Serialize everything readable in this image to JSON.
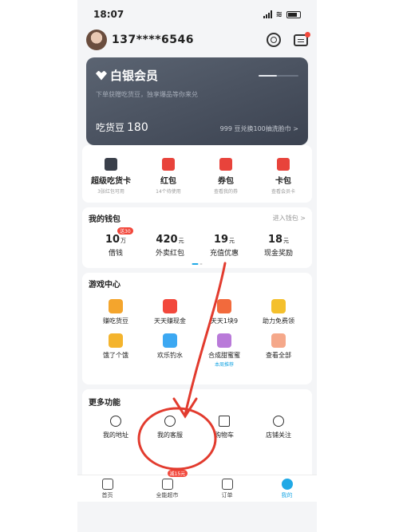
{
  "status": {
    "time": "18:07"
  },
  "header": {
    "phone": "137****6546"
  },
  "member": {
    "title": "白银会员",
    "subtitle": "下单获赠吃货豆，独享爆品等你来兑",
    "progress_fraction": 0.45,
    "beans_label": "吃货豆",
    "beans_value": "180",
    "exchange_link": "999 豆兑换100抽洗脸巾 >"
  },
  "quick": [
    {
      "label": "超级吃货卡",
      "sub": "3张红包可用",
      "icon": "member-card-icon"
    },
    {
      "label": "红包",
      "sub": "14个待使用",
      "icon": "red-packet-icon"
    },
    {
      "label": "券包",
      "sub": "查看我的券",
      "icon": "coupon-icon"
    },
    {
      "label": "卡包",
      "sub": "查看会员卡",
      "icon": "card-wallet-icon"
    }
  ],
  "wallet": {
    "title": "我的钱包",
    "link": "进入钱包 >",
    "items": [
      {
        "value": "10",
        "unit": "万",
        "label": "借钱",
        "badge": "送30"
      },
      {
        "value": "420",
        "unit": "元",
        "label": "外卖红包",
        "badge": ""
      },
      {
        "value": "19",
        "unit": "元",
        "label": "充值优惠",
        "badge": ""
      },
      {
        "value": "18",
        "unit": "元",
        "label": "现金奖励",
        "badge": ""
      }
    ]
  },
  "games": {
    "title": "游戏中心",
    "items": [
      {
        "label": "赚吃货豆",
        "color": "#f4a52d",
        "badge": ""
      },
      {
        "label": "天天赚现金",
        "color": "#f2483c",
        "badge": ""
      },
      {
        "label": "天天1块9",
        "color": "#f26a3c",
        "badge": ""
      },
      {
        "label": "助力免费领",
        "color": "#f4c02d",
        "badge": ""
      },
      {
        "label": "饿了个饿",
        "color": "#f4b42d",
        "badge": ""
      },
      {
        "label": "欢乐钓水",
        "color": "#3ca8f2",
        "badge": ""
      },
      {
        "label": "合成甜蜜蜜",
        "color": "#b97ad9",
        "badge": "本周推荐"
      },
      {
        "label": "查看全部",
        "color": "#f5a88a",
        "badge": ""
      }
    ]
  },
  "more": {
    "title": "更多功能",
    "items": [
      {
        "label": "我的地址",
        "icon": "location-icon"
      },
      {
        "label": "我的客服",
        "icon": "headset-icon"
      },
      {
        "label": "购物车",
        "icon": "cart-icon"
      },
      {
        "label": "店铺关注",
        "icon": "heart-icon"
      }
    ]
  },
  "tabbar": [
    {
      "label": "首页",
      "icon": "home-icon",
      "badge": ""
    },
    {
      "label": "全能超市",
      "icon": "supermarket-icon",
      "badge": "减15元"
    },
    {
      "label": "订单",
      "icon": "order-icon",
      "badge": ""
    },
    {
      "label": "我的",
      "icon": "me-icon",
      "badge": ""
    }
  ],
  "colors": {
    "accent": "#20a9e6",
    "red": "#f2483c",
    "annotation": "#e23b2e"
  }
}
